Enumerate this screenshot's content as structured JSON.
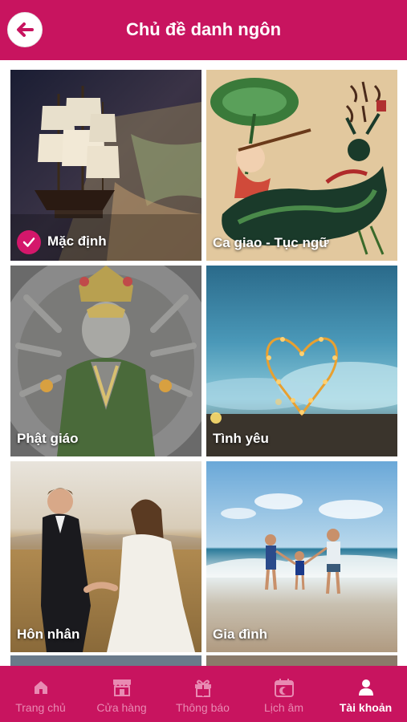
{
  "header": {
    "title": "Chủ đề danh ngôn"
  },
  "topics": [
    {
      "label": "Mặc định",
      "selected": true
    },
    {
      "label": "Ca giao - Tục ngữ",
      "selected": false
    },
    {
      "label": "Phật giáo",
      "selected": false
    },
    {
      "label": "Tình yêu",
      "selected": false
    },
    {
      "label": "Hôn nhân",
      "selected": false
    },
    {
      "label": "Gia đình",
      "selected": false
    }
  ],
  "tabs": [
    {
      "label": "Trang chủ",
      "icon": "home-icon"
    },
    {
      "label": "Cửa hàng",
      "icon": "store-icon"
    },
    {
      "label": "Thông báo",
      "icon": "gift-icon"
    },
    {
      "label": "Lịch âm",
      "icon": "calendar-moon-icon"
    },
    {
      "label": "Tài khoản",
      "icon": "person-icon",
      "active": true
    }
  ],
  "colors": {
    "brand": "#c8145f",
    "check": "#d4176b",
    "tab_inactive": "#e88ab2"
  }
}
